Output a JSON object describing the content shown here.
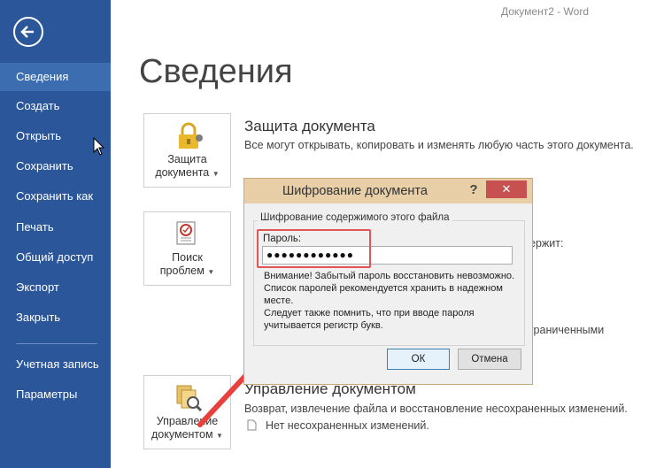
{
  "window": {
    "title": "Документ2 - Word"
  },
  "page": {
    "title": "Сведения"
  },
  "sidebar": {
    "items": [
      {
        "label": "Сведения"
      },
      {
        "label": "Создать"
      },
      {
        "label": "Открыть"
      },
      {
        "label": "Сохранить"
      },
      {
        "label": "Сохранить как"
      },
      {
        "label": "Печать"
      },
      {
        "label": "Общий доступ"
      },
      {
        "label": "Экспорт"
      },
      {
        "label": "Закрыть"
      },
      {
        "label": "Учетная запись"
      },
      {
        "label": "Параметры"
      }
    ]
  },
  "protect": {
    "card_line1": "Защита",
    "card_line2": "документа",
    "title": "Защита документа",
    "text": "Все могут открывать, копировать и изменять любую часть этого документа."
  },
  "inspect": {
    "card_line1": "Поиск",
    "card_line2": "проблем",
    "partial1": "ержит:",
    "partial2": "граниченными"
  },
  "manage": {
    "card_line1": "Управление",
    "card_line2": "документом",
    "title": "Управление документом",
    "text": "Возврат, извлечение файла и восстановление несохраненных изменений.",
    "sub": "Нет несохраненных изменений."
  },
  "dialog": {
    "title": "Шифрование документа",
    "help": "?",
    "close": "✕",
    "group_title": "Шифрование содержимого этого файла",
    "password_label": "Пароль:",
    "password_value": "●●●●●●●●●●●●",
    "warning_line1": "Внимание! Забытый пароль восстановить невозможно.",
    "warning_line2": "Список паролей рекомендуется хранить в надежном",
    "warning_line3": "месте.",
    "warning_line4": "Следует также помнить, что при вводе пароля",
    "warning_line5": "учитывается регистр букв.",
    "ok": "ОК",
    "cancel": "Отмена"
  },
  "colors": {
    "sidebar": "#2b579a",
    "dialog_title": "#e8cfa7",
    "close": "#c75050",
    "highlight": "#e25555"
  },
  "icons": [
    "back-arrow-icon",
    "lock-key-icon",
    "inspect-checklist-icon",
    "manage-document-icon",
    "document-small-icon",
    "mouse-cursor-icon",
    "red-arrow-annotation"
  ]
}
